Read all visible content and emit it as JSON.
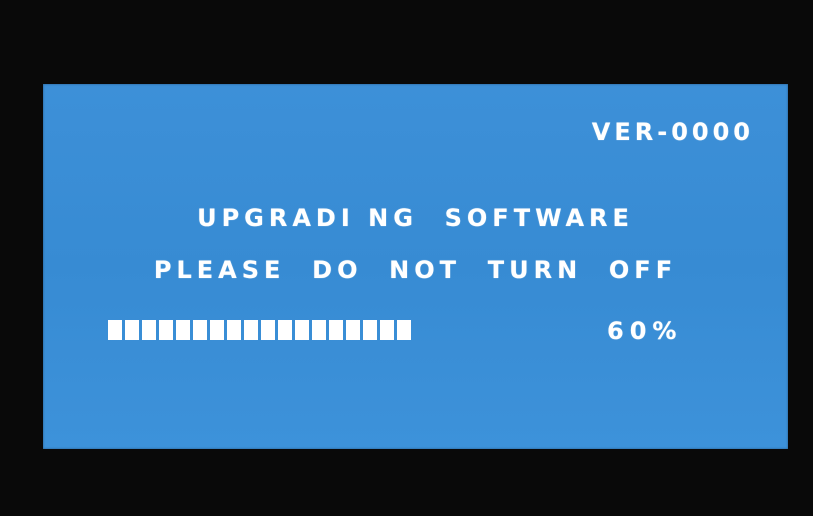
{
  "screen": {
    "version_label": "VER-0000",
    "message_line1": "UPGRADI NG  SOFTWARE",
    "message_line2": "PLEASE  DO  NOT  TURN  OFF",
    "progress": {
      "percent_label": "60%",
      "fraction": 0.6,
      "filled_segments": 18
    },
    "colors": {
      "screen_background": "#3a8fd6",
      "text": "#ffffff",
      "bezel": "#090909"
    }
  }
}
